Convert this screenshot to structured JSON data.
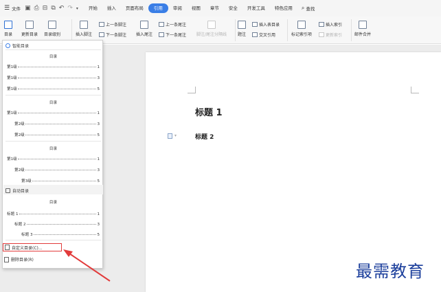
{
  "menubar": {
    "file_label": "文件",
    "tabs": [
      {
        "label": "开始",
        "active": false
      },
      {
        "label": "插入",
        "active": false
      },
      {
        "label": "页面布局",
        "active": false
      },
      {
        "label": "引用",
        "active": true
      },
      {
        "label": "审阅",
        "active": false
      },
      {
        "label": "视图",
        "active": false
      },
      {
        "label": "章节",
        "active": false
      },
      {
        "label": "安全",
        "active": false
      },
      {
        "label": "开发工具",
        "active": false
      },
      {
        "label": "特色应用",
        "active": false
      }
    ],
    "search_label": "查找"
  },
  "ribbon": {
    "toc": "目录",
    "update_toc": "更新目录",
    "toc_level": "目录级别",
    "insert_footnote": "插入脚注",
    "prev_footnote": "上一条脚注",
    "next_footnote": "下一条脚注",
    "insert_endnote": "插入尾注",
    "prev_endnote": "上一条尾注",
    "next_endnote": "下一条尾注",
    "footnote_sep": "脚注/尾注分隔线",
    "caption": "题注",
    "insert_figure_toc": "插入表目录",
    "cross_ref": "交叉引用",
    "mark_index": "标记索引项",
    "insert_index": "插入索引",
    "update_index": "更新索引",
    "mail_merge": "邮件合并"
  },
  "dropdown": {
    "smart_toc": "智能目录",
    "auto_toc": "自动目录",
    "toc_title": "目录",
    "block1": [
      {
        "label": "第1级",
        "page": "1"
      },
      {
        "label": "第1级",
        "page": "3"
      },
      {
        "label": "第1级",
        "page": "5"
      }
    ],
    "block2": [
      {
        "label": "第1级",
        "page": "1"
      },
      {
        "label": "第2级",
        "page": "3"
      },
      {
        "label": "第2级",
        "page": "5"
      }
    ],
    "block3": [
      {
        "label": "第1级",
        "page": "1"
      },
      {
        "label": "第2级",
        "page": "3"
      },
      {
        "label": "第3级",
        "page": "5"
      }
    ],
    "block4": [
      {
        "label": "标题 1",
        "page": "1"
      },
      {
        "label": "标题 2",
        "page": "3"
      },
      {
        "label": "标题 3",
        "page": "5"
      }
    ],
    "custom_toc": "自定义目录(C)...",
    "delete_toc": "删除目录(R)"
  },
  "document": {
    "heading1": "标题 1",
    "heading2": "标题 2"
  },
  "watermark": "最需教育"
}
